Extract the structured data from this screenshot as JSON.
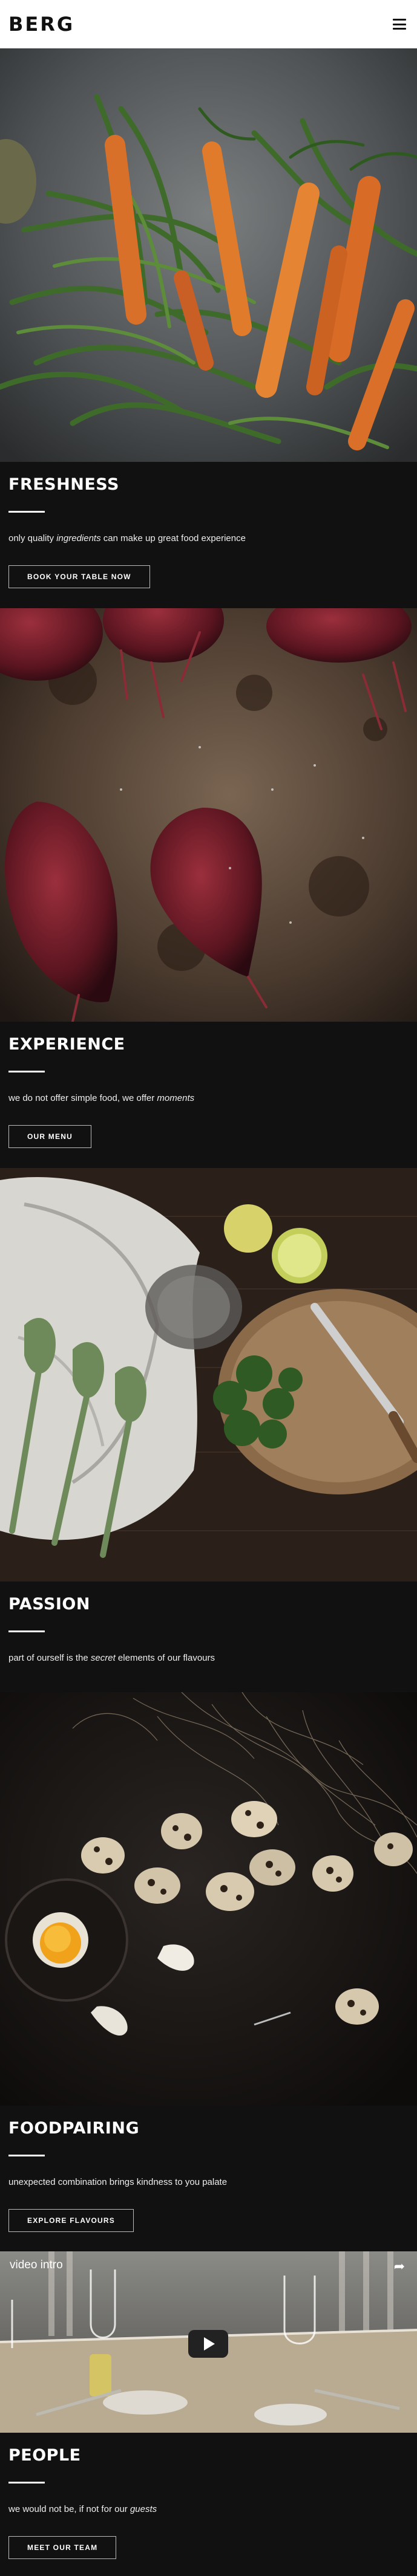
{
  "header": {
    "logo": "BERG",
    "menu_icon": "hamburger-menu-icon"
  },
  "sections": [
    {
      "title": "FRESHNESS",
      "text_before": "only quality ",
      "text_em": "ingredients",
      "text_after": " can make up great food experience",
      "button": "BOOK YOUR TABLE NOW",
      "image": "carrots-and-green-beans"
    },
    {
      "title": "EXPERIENCE",
      "text_before": "we do not offer simple food, we offer ",
      "text_em": "moments",
      "text_after": "",
      "button": "OUR MENU",
      "image": "roasted-beetroots"
    },
    {
      "title": "PASSION",
      "text_before": "part of ourself is the ",
      "text_em": "secret",
      "text_after": " elements of our flavours",
      "button": "",
      "image": "artichokes-limes-parsley"
    },
    {
      "title": "FOODPAIRING",
      "text_before": "unexpected combination brings kindness to you palate",
      "text_em": "",
      "text_after": "",
      "button": "EXPLORE FLAVOURS",
      "image": "quail-eggs-on-dark-table"
    },
    {
      "title": "PEOPLE",
      "text_before": "we would not be, if not for our ",
      "text_em": "guests",
      "text_after": "",
      "button": "MEET OUR TEAM",
      "image": ""
    }
  ],
  "video": {
    "title": "video intro",
    "share_icon": "share-arrow-icon",
    "play_icon": "play-button-icon"
  },
  "colors": {
    "background": "#111111",
    "header": "#ffffff",
    "text": "#ffffff"
  }
}
